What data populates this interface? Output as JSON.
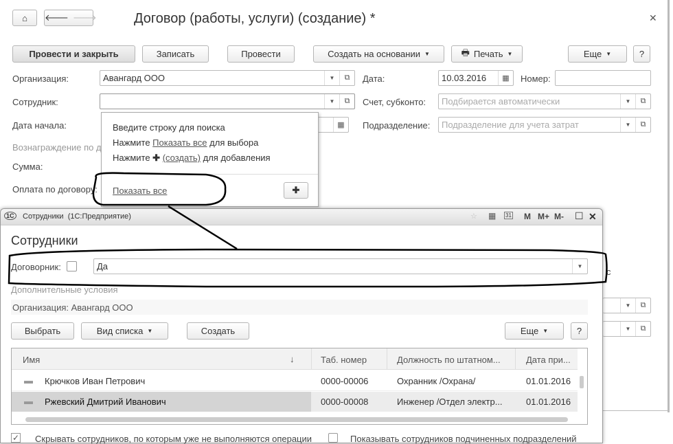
{
  "main": {
    "title": "Договор (работы, услуги) (создание) *",
    "toolbar": {
      "post_close": "Провести и закрыть",
      "save": "Записать",
      "post": "Провести",
      "create_based": "Создать на основании",
      "print": "Печать",
      "more": "Еще",
      "help": "?"
    },
    "fields": {
      "org_label": "Организация:",
      "org_value": "Авангард ООО",
      "date_label": "Дата:",
      "date_value": "10.03.2016",
      "number_label": "Номер:",
      "employee_label": "Сотрудник:",
      "account_label": "Счет, субконто:",
      "account_placeholder": "Подбирается автоматически",
      "start_label": "Дата начала:",
      "dept_label": "Подразделение:",
      "dept_placeholder": "Подразделение для учета затрат",
      "reward_label": "Вознаграждение по д",
      "sum_label": "Сумма:",
      "payment_label": "Оплата по договору:"
    }
  },
  "popup": {
    "line1": "Введите строку для поиска",
    "line2_pre": "Нажмите ",
    "line2_link": "Показать все",
    "line2_post": " для выбора",
    "line3_pre": "Нажмите ",
    "line3_link": "(создать)",
    "line3_post": " для добавления",
    "show_all": "Показать все"
  },
  "dialog": {
    "window_title": "Сотрудники  (1С:Предприятие)",
    "memory_buttons": [
      "M",
      "M+",
      "M-"
    ],
    "calendar_day": "31",
    "heading": "Сотрудники",
    "contractor_label": "Договорник:",
    "contractor_checked": false,
    "contractor_value": "Да",
    "extra_conditions": "Дополнительные условия",
    "org_info": "Организация: Авангард ООО",
    "buttons": {
      "select": "Выбрать",
      "view": "Вид списка",
      "create": "Создать",
      "more": "Еще",
      "help": "?"
    },
    "columns": [
      "Имя",
      "Таб. номер",
      "Должность по штатном...",
      "Дата при..."
    ],
    "rows": [
      {
        "name": "Крючков Иван Петрович",
        "tab": "0000-00006",
        "position": "Охранник /Охрана/",
        "date": "01.01.2016",
        "selected": false
      },
      {
        "name": "Ржевский Дмитрий Иванович",
        "tab": "0000-00008",
        "position": "Инженер /Отдел электр...",
        "date": "01.01.2016",
        "selected": true
      }
    ],
    "hide_inactive_label": "Скрывать сотрудников, по которым уже не выполняются операции",
    "hide_inactive_checked": true,
    "show_sub_label": "Показывать сотрудников подчиненных подразделений",
    "show_sub_checked": false
  }
}
